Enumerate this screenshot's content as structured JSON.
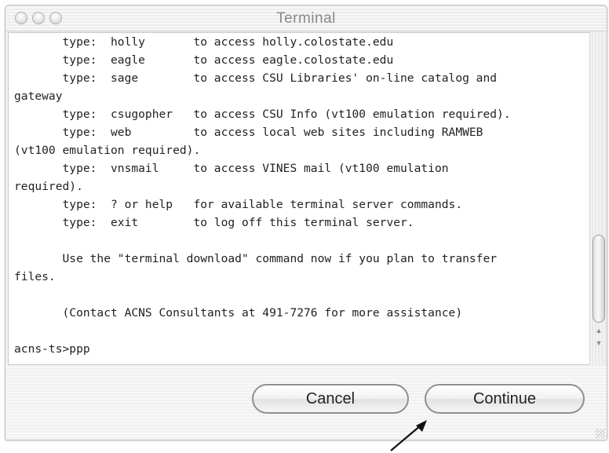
{
  "window": {
    "title": "Terminal"
  },
  "terminal": {
    "lines": [
      "       type:  holly       to access holly.colostate.edu",
      "       type:  eagle       to access eagle.colostate.edu",
      "       type:  sage        to access CSU Libraries' on-line catalog and",
      "gateway",
      "       type:  csugopher   to access CSU Info (vt100 emulation required).",
      "       type:  web         to access local web sites including RAMWEB",
      "(vt100 emulation required).",
      "       type:  vnsmail     to access VINES mail (vt100 emulation",
      "required).",
      "       type:  ? or help   for available terminal server commands.",
      "       type:  exit        to log off this terminal server.",
      "",
      "       Use the \"terminal download\" command now if you plan to transfer",
      "files.",
      "",
      "       (Contact ACNS Consultants at 491-7276 for more assistance)",
      "",
      "acns-ts>ppp"
    ]
  },
  "buttons": {
    "cancel": "Cancel",
    "continue": "Continue"
  },
  "scrollbar": {
    "up_icon": "triangle-up",
    "down_icon": "triangle-down"
  },
  "icons": {
    "annotation": "arrow-icon",
    "close": "close-icon",
    "minimize": "minimize-icon",
    "zoom": "zoom-icon",
    "resize": "resize-grip-icon"
  }
}
